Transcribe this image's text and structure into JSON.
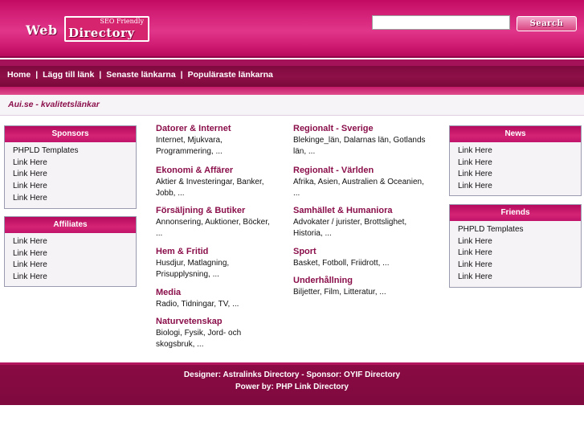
{
  "header": {
    "logo_web": "Web",
    "logo_directory": "Directory",
    "logo_tagline": "SEO Friendly",
    "search_placeholder": "",
    "search_button": "Search"
  },
  "nav": {
    "items": [
      "Home",
      "Lägg till länk",
      "Senaste länkarna",
      "Populäraste länkarna"
    ],
    "separator": "|"
  },
  "breadcrumb": "Aui.se - kvalitetslänkar",
  "left": {
    "sponsors": {
      "title": "Sponsors",
      "items": [
        "PHPLD Templates",
        "Link Here",
        "Link Here",
        "Link Here",
        "Link Here"
      ]
    },
    "affiliates": {
      "title": "Affiliates",
      "items": [
        "Link Here",
        "Link Here",
        "Link Here",
        "Link Here"
      ]
    }
  },
  "right": {
    "news": {
      "title": "News",
      "items": [
        "Link Here",
        "Link Here",
        "Link Here",
        "Link Here"
      ]
    },
    "friends": {
      "title": "Friends",
      "items": [
        "PHPLD Templates",
        "Link Here",
        "Link Here",
        "Link Here",
        "Link Here"
      ]
    }
  },
  "categories": {
    "col1": [
      {
        "title": "Datorer & Internet",
        "sub": "Internet, Mjukvara, Programmering, ..."
      },
      {
        "title": "Ekonomi & Affärer",
        "sub": "Aktier & Investeringar, Banker, Jobb, ..."
      },
      {
        "title": "Försäljning & Butiker",
        "sub": "Annonsering, Auktioner, Böcker, ..."
      },
      {
        "title": "Hem & Fritid",
        "sub": "Husdjur, Matlagning, Prisupplysning, ..."
      },
      {
        "title": "Media",
        "sub": "Radio, Tidningar, TV, ..."
      },
      {
        "title": "Naturvetenskap",
        "sub": "Biologi, Fysik, Jord- och skogsbruk, ..."
      }
    ],
    "col2": [
      {
        "title": "Regionalt - Sverige",
        "sub": "Blekinge_län, Dalarnas län, Gotlands län, ..."
      },
      {
        "title": "Regionalt - Världen",
        "sub": "Afrika, Asien, Australien & Oceanien, ..."
      },
      {
        "title": "Samhället & Humaniora",
        "sub": "Advokater / jurister, Brottslighet, Historia, ..."
      },
      {
        "title": "Sport",
        "sub": "Basket, Fotboll, Friidrott, ..."
      },
      {
        "title": "Underhållning",
        "sub": "Biljetter, Film, Litteratur, ..."
      }
    ]
  },
  "footer": {
    "line1": "Designer: Astralinks Directory - Sponsor: OYIF Directory",
    "line2": "Power by: PHP Link Directory"
  }
}
